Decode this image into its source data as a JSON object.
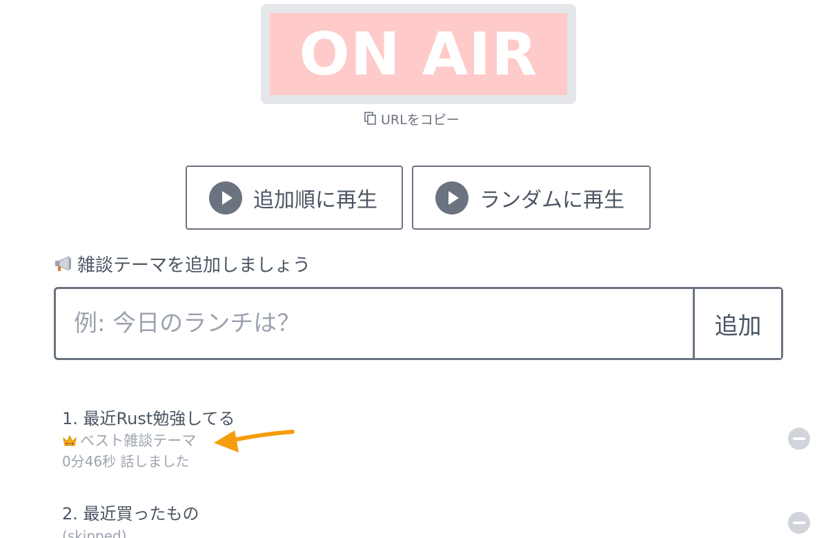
{
  "sign": {
    "label": "ON AIR",
    "frame_color": "#e5e7eb",
    "fill_color": "#fecaca"
  },
  "copy_url": {
    "label": "URLをコピー",
    "icon": "copy-icon"
  },
  "play_buttons": {
    "sequential": "追加順に再生",
    "random": "ランダムに再生",
    "icon": "play-icon"
  },
  "add_topic": {
    "heading": "雑談テーマを追加しましょう",
    "heading_icon": "megaphone-icon",
    "placeholder": "例: 今日のランチは？",
    "value": "",
    "button_label": "追加"
  },
  "topics": [
    {
      "title": "1. 最近Rust勉強してる",
      "badge": "ベスト雑談テーマ",
      "badge_icon": "crown-icon",
      "meta": "0分46秒 話しました"
    },
    {
      "title": "2. 最近買ったもの",
      "meta": "(skipped)"
    }
  ],
  "annotation": {
    "type": "arrow",
    "color": "#f59e0b"
  },
  "colors": {
    "text": "#4b5563",
    "muted": "#9ca3af",
    "border": "#6b7280",
    "remove": "#d1d5db"
  }
}
